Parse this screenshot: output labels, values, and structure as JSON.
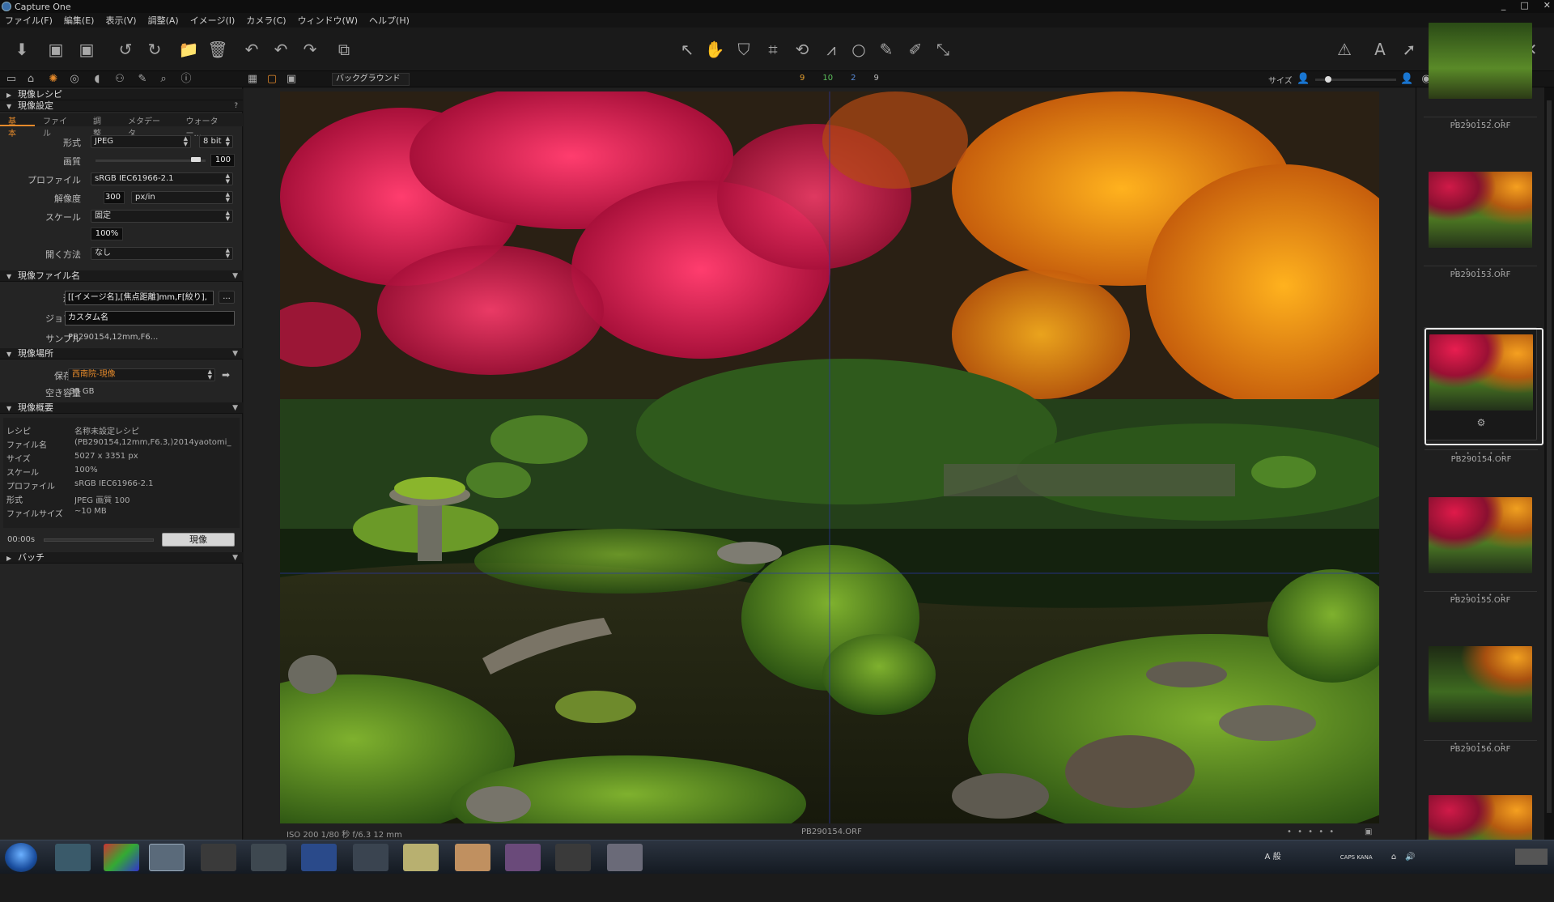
{
  "window": {
    "title": "Capture One",
    "controls": [
      "_",
      "□",
      "✕"
    ]
  },
  "menu": [
    "ファイル(F)",
    "編集(E)",
    "表示(V)",
    "調整(A)",
    "イメージ(I)",
    "カメラ(C)",
    "ウィンドウ(W)",
    "ヘルプ(H)"
  ],
  "subbar": {
    "background_label": "バックグラウンド",
    "counts": [
      "9",
      "10",
      "2",
      "9"
    ],
    "size_label": "サイズ"
  },
  "left": {
    "sections": {
      "recipe": "現像レシピ",
      "settings": "現像設定",
      "filename": "現像ファイル名",
      "location": "現像場所",
      "summary": "現像概要",
      "batch": "バッチ"
    },
    "settings_question": "?",
    "tabs": [
      "基本",
      "ファイル",
      "調整",
      "メタデータ",
      "ウォーター..."
    ],
    "basic": {
      "format_label": "形式",
      "format_value": "JPEG",
      "bit_value": "8 bit",
      "quality_label": "画質",
      "quality_value": "100",
      "profile_label": "プロファイル",
      "profile_value": "sRGB IEC61966-2.1",
      "resolution_label": "解像度",
      "resolution_value": "300",
      "resolution_unit": "px/in",
      "scale_label": "スケール",
      "scale_value": "固定",
      "scale_percent": "100%",
      "open_label": "開く方法",
      "open_value": "なし"
    },
    "filename": {
      "format_label": "形式",
      "format_value": "[[イメージ名],[焦点距離]mm,F[絞り],",
      "more_label": "...",
      "job_label": "ジョブ名",
      "job_value": "カスタム名",
      "sample_label": "サンプル",
      "sample_value": "PB290154,12mm,F6..."
    },
    "location": {
      "dest_label": "保存先",
      "dest_value": "西南院-現像",
      "free_label": "空き容量",
      "free_value": "35 GB"
    },
    "summary": [
      {
        "k": "レシピ",
        "v": "名称未設定レシピ"
      },
      {
        "k": "ファイル名",
        "v": "(PB290154,12mm,F6.3,)2014yaotomi_"
      },
      {
        "k": "サイズ",
        "v": "5027 x 3351 px"
      },
      {
        "k": "スケール",
        "v": "100%"
      },
      {
        "k": "プロファイル",
        "v": "sRGB IEC61966-2.1"
      },
      {
        "k": "形式",
        "v": "JPEG 画質 100"
      },
      {
        "k": "ファイルサイズ",
        "v": "~10 MB"
      }
    ],
    "time_value": "00:00s",
    "process_button": "現像"
  },
  "viewer": {
    "exif": "ISO 200   1/80 秒  f/6.3  12 mm",
    "filename": "PB290154.ORF",
    "dots": "• • • • •"
  },
  "filmstrip": [
    {
      "name": "PB290152.ORF",
      "selected": false
    },
    {
      "name": "PB290153.ORF",
      "selected": false
    },
    {
      "name": "PB290154.ORF",
      "selected": true
    },
    {
      "name": "PB290155.ORF",
      "selected": false
    },
    {
      "name": "PB290156.ORF",
      "selected": false
    }
  ],
  "thumb_dots": "• • • • •",
  "taskbar": {
    "tray_text": "A 般",
    "tray_caps": "CAPS KANA"
  },
  "colors": {
    "accent": "#e58a2b",
    "panel": "#242424",
    "toolbar": "#1a1a1a"
  }
}
